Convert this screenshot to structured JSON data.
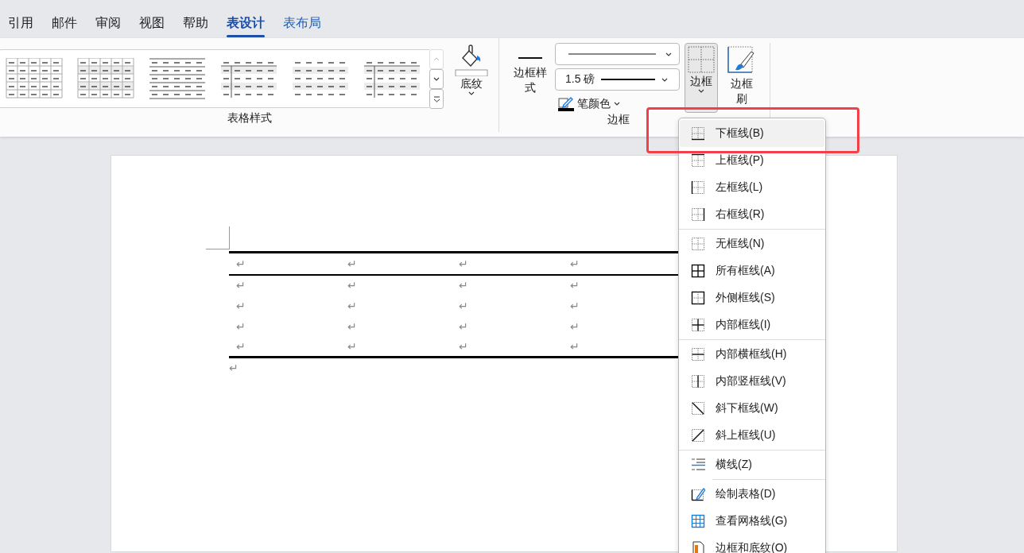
{
  "tabs": [
    {
      "label": "引用",
      "selected": false,
      "kind": "standard"
    },
    {
      "label": "邮件",
      "selected": false,
      "kind": "standard"
    },
    {
      "label": "审阅",
      "selected": false,
      "kind": "standard"
    },
    {
      "label": "视图",
      "selected": false,
      "kind": "standard"
    },
    {
      "label": "帮助",
      "selected": false,
      "kind": "standard"
    },
    {
      "label": "表设计",
      "selected": true,
      "kind": "contextual"
    },
    {
      "label": "表布局",
      "selected": false,
      "kind": "contextual"
    }
  ],
  "ribbon": {
    "table_styles": {
      "label": "表格样式",
      "shading_button": "底纹"
    },
    "borders": {
      "label": "边框",
      "border_styles_button": "边框样式",
      "line_weight": "1.5 磅",
      "pen_color": "笔颜色",
      "borders_button": {
        "label": "边框",
        "pressed": true
      },
      "border_painter": "边框刷"
    }
  },
  "border_menu": {
    "sections": [
      {
        "items": [
          {
            "kind": "bottom",
            "label": "下框线(B)",
            "selected": true
          },
          {
            "kind": "top",
            "label": "上框线(P)",
            "selected": false
          },
          {
            "kind": "left",
            "label": "左框线(L)",
            "selected": false
          },
          {
            "kind": "right",
            "label": "右框线(R)",
            "selected": false
          }
        ]
      },
      {
        "items": [
          {
            "kind": "none",
            "label": "无框线(N)",
            "selected": false
          },
          {
            "kind": "all",
            "label": "所有框线(A)",
            "selected": false
          },
          {
            "kind": "outside",
            "label": "外侧框线(S)",
            "selected": false
          },
          {
            "kind": "inside",
            "label": "内部框线(I)",
            "selected": false
          }
        ]
      },
      {
        "items": [
          {
            "kind": "inside_h",
            "label": "内部横框线(H)",
            "selected": false
          },
          {
            "kind": "inside_v",
            "label": "内部竖框线(V)",
            "selected": false
          },
          {
            "kind": "diag_down",
            "label": "斜下框线(W)",
            "selected": false
          },
          {
            "kind": "diag_up",
            "label": "斜上框线(U)",
            "selected": false
          }
        ]
      },
      {
        "items": [
          {
            "kind": "hline",
            "label": "横线(Z)",
            "selected": false
          }
        ]
      },
      {
        "items": [
          {
            "kind": "draw",
            "label": "绘制表格(D)",
            "selected": false
          },
          {
            "kind": "gridlines",
            "label": "查看网格线(G)",
            "selected": false
          },
          {
            "kind": "borders_shading",
            "label": "边框和底纹(O)",
            "selected": false
          }
        ]
      }
    ]
  },
  "document": {
    "table": {
      "rows": [
        [
          "↵",
          "↵",
          "↵",
          "↵"
        ],
        [
          "↵",
          "↵",
          "↵",
          "↵"
        ],
        [
          "↵",
          "↵",
          "↵",
          "↵"
        ],
        [
          "↵",
          "↵",
          "↵",
          "↵"
        ],
        [
          "↵",
          "↵",
          "↵",
          "↵"
        ]
      ]
    },
    "paragraph_mark": "↵"
  }
}
